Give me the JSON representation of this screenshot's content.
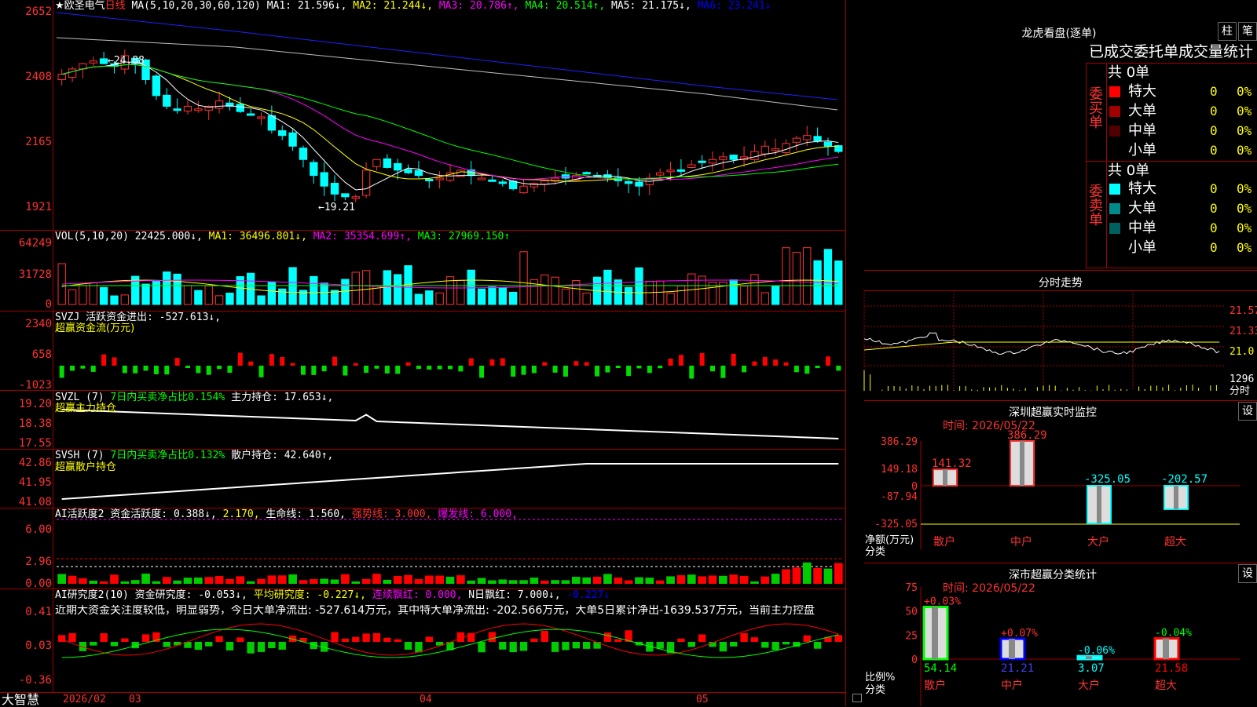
{
  "stock": {
    "name": "★欧圣电气",
    "period": "日线"
  },
  "ma_legend": {
    "params": "MA(5,10,20,30,60,120)",
    "ma1": "MA1: 21.596↓,",
    "ma2": "MA2: 21.244↓,",
    "ma3": "MA3: 20.786↑,",
    "ma4": "MA4: 20.514↑,",
    "ma5": "MA5: 21.175↓,",
    "ma6": "MA6: 23.241↓"
  },
  "price_axis": [
    "2652",
    "2408",
    "2165",
    "1921"
  ],
  "price_annotations": {
    "high": "←24.88",
    "low": "←19.21"
  },
  "vol": {
    "params": "VOL(5,10,20)",
    "value": "22425.000↓,",
    "ma1": "MA1: 36496.801↓,",
    "ma2": "MA2: 35354.699↑,",
    "ma3": "MA3: 27969.150↑",
    "axis": [
      "64249",
      "31728",
      "0"
    ]
  },
  "svzj": {
    "line1": "SVZJ  活跃资金进出: -527.613↓,",
    "line2": "超赢资金流(万元)",
    "axis": [
      "2340",
      "658",
      "-1023"
    ]
  },
  "svzl": {
    "a": "SVZL (7)",
    "b": "7日内买卖净占比0.154%",
    "c": "主力持仓: 17.653↓,",
    "line2": "超赢主力持仓",
    "axis": [
      "19.20",
      "18.38",
      "17.55"
    ]
  },
  "svsh": {
    "a": "SVSH (7)",
    "b": "7日内买卖净占比0.132%",
    "c": "散户持仓: 42.640↑,",
    "line2": "超赢散户持仓",
    "axis": [
      "42.86",
      "41.95",
      "41.08"
    ]
  },
  "ai1": {
    "a": "AI活跃度2 资金活跃度: 0.388↓,",
    "b": "2.170,",
    "c": "生命线: 1.560,",
    "d": "强势线: 3.000,",
    "e": "爆发线: 6.000,",
    "axis": [
      "6.00",
      "2.96",
      "0.00"
    ]
  },
  "ai2": {
    "a": "AI研究度2(10) 资金研究度: -0.053↓,",
    "b": "平均研究度: -0.227↓,",
    "c": "连续飘红: 0.000,",
    "d": "N日飘红: 7.000↓,",
    "e": "-0.227↓",
    "axis": [
      "0.41",
      "0.03",
      "-0.36"
    ]
  },
  "ai_comment": "近期大资金关注度较低，明显弱势，今日大单净流出: -527.614万元，其中特大单净流出: -202.566万元，大单5日累计净出-1639.537万元，当前主力控盘",
  "footer": {
    "brand": "大智慧",
    "date": "2026/02",
    "m1": "03",
    "m2": "04",
    "m3": "05"
  },
  "right": {
    "dragon_title": "龙虎看盘(逐单)",
    "btn_zhu": "柱",
    "btn_bi": "笔",
    "stat_title": "已成交委托单成交量统计",
    "buy_label": "委买单",
    "sell_label": "委卖单",
    "buy_total": "共 0单",
    "sell_total": "共 0单",
    "buy_rows": [
      {
        "name": "特大",
        "vol": "0",
        "pct": "0%",
        "color": "#ff0000"
      },
      {
        "name": "大单",
        "vol": "0",
        "pct": "0%",
        "color": "#a00000"
      },
      {
        "name": "中单",
        "vol": "0",
        "pct": "0%",
        "color": "#500000"
      },
      {
        "name": "小单",
        "vol": "0",
        "pct": "0%",
        "color": "#000000"
      }
    ],
    "sell_rows": [
      {
        "name": "特大",
        "vol": "0",
        "pct": "0%",
        "color": "#00ffff"
      },
      {
        "name": "大单",
        "vol": "0",
        "pct": "0%",
        "color": "#008b8b"
      },
      {
        "name": "中单",
        "vol": "0",
        "pct": "0%",
        "color": "#006060"
      },
      {
        "name": "小单",
        "vol": "0",
        "pct": "0%",
        "color": "#000000"
      }
    ],
    "intraday_title": "分时走势",
    "intraday_axis": [
      "21.57",
      "21.33",
      "21.0",
      "1296",
      "分时"
    ],
    "monitor_title": "深圳超赢实时监控",
    "set_btn": "设",
    "monitor_time": "时间: 2026/05/22",
    "monitor_axis": [
      "386.29",
      "149.18",
      "0",
      "-87.94",
      "-325.05"
    ],
    "monitor_values": [
      "141.32",
      "386.29",
      "-325.05",
      "-202.57"
    ],
    "monitor_cats": [
      "散户",
      "中户",
      "大户",
      "超大"
    ],
    "net_label": "净额(万元)",
    "cat_label": "分类",
    "class_title": "深市超赢分类统计",
    "class_time": "时间: 2026/05/22",
    "class_axis": [
      "75",
      "50",
      "25",
      "0"
    ],
    "class_top": [
      "+0.03%",
      "+0.07%",
      "-0.06%",
      "-0.04%"
    ],
    "class_bottom": [
      "54.14",
      "21.21",
      "3.07",
      "21.58"
    ],
    "ratio_label": "比例%",
    "class_cat_label": "分类"
  },
  "colors": {
    "up": "#ff3232",
    "down": "#00ffff",
    "grid": "#a00000"
  }
}
